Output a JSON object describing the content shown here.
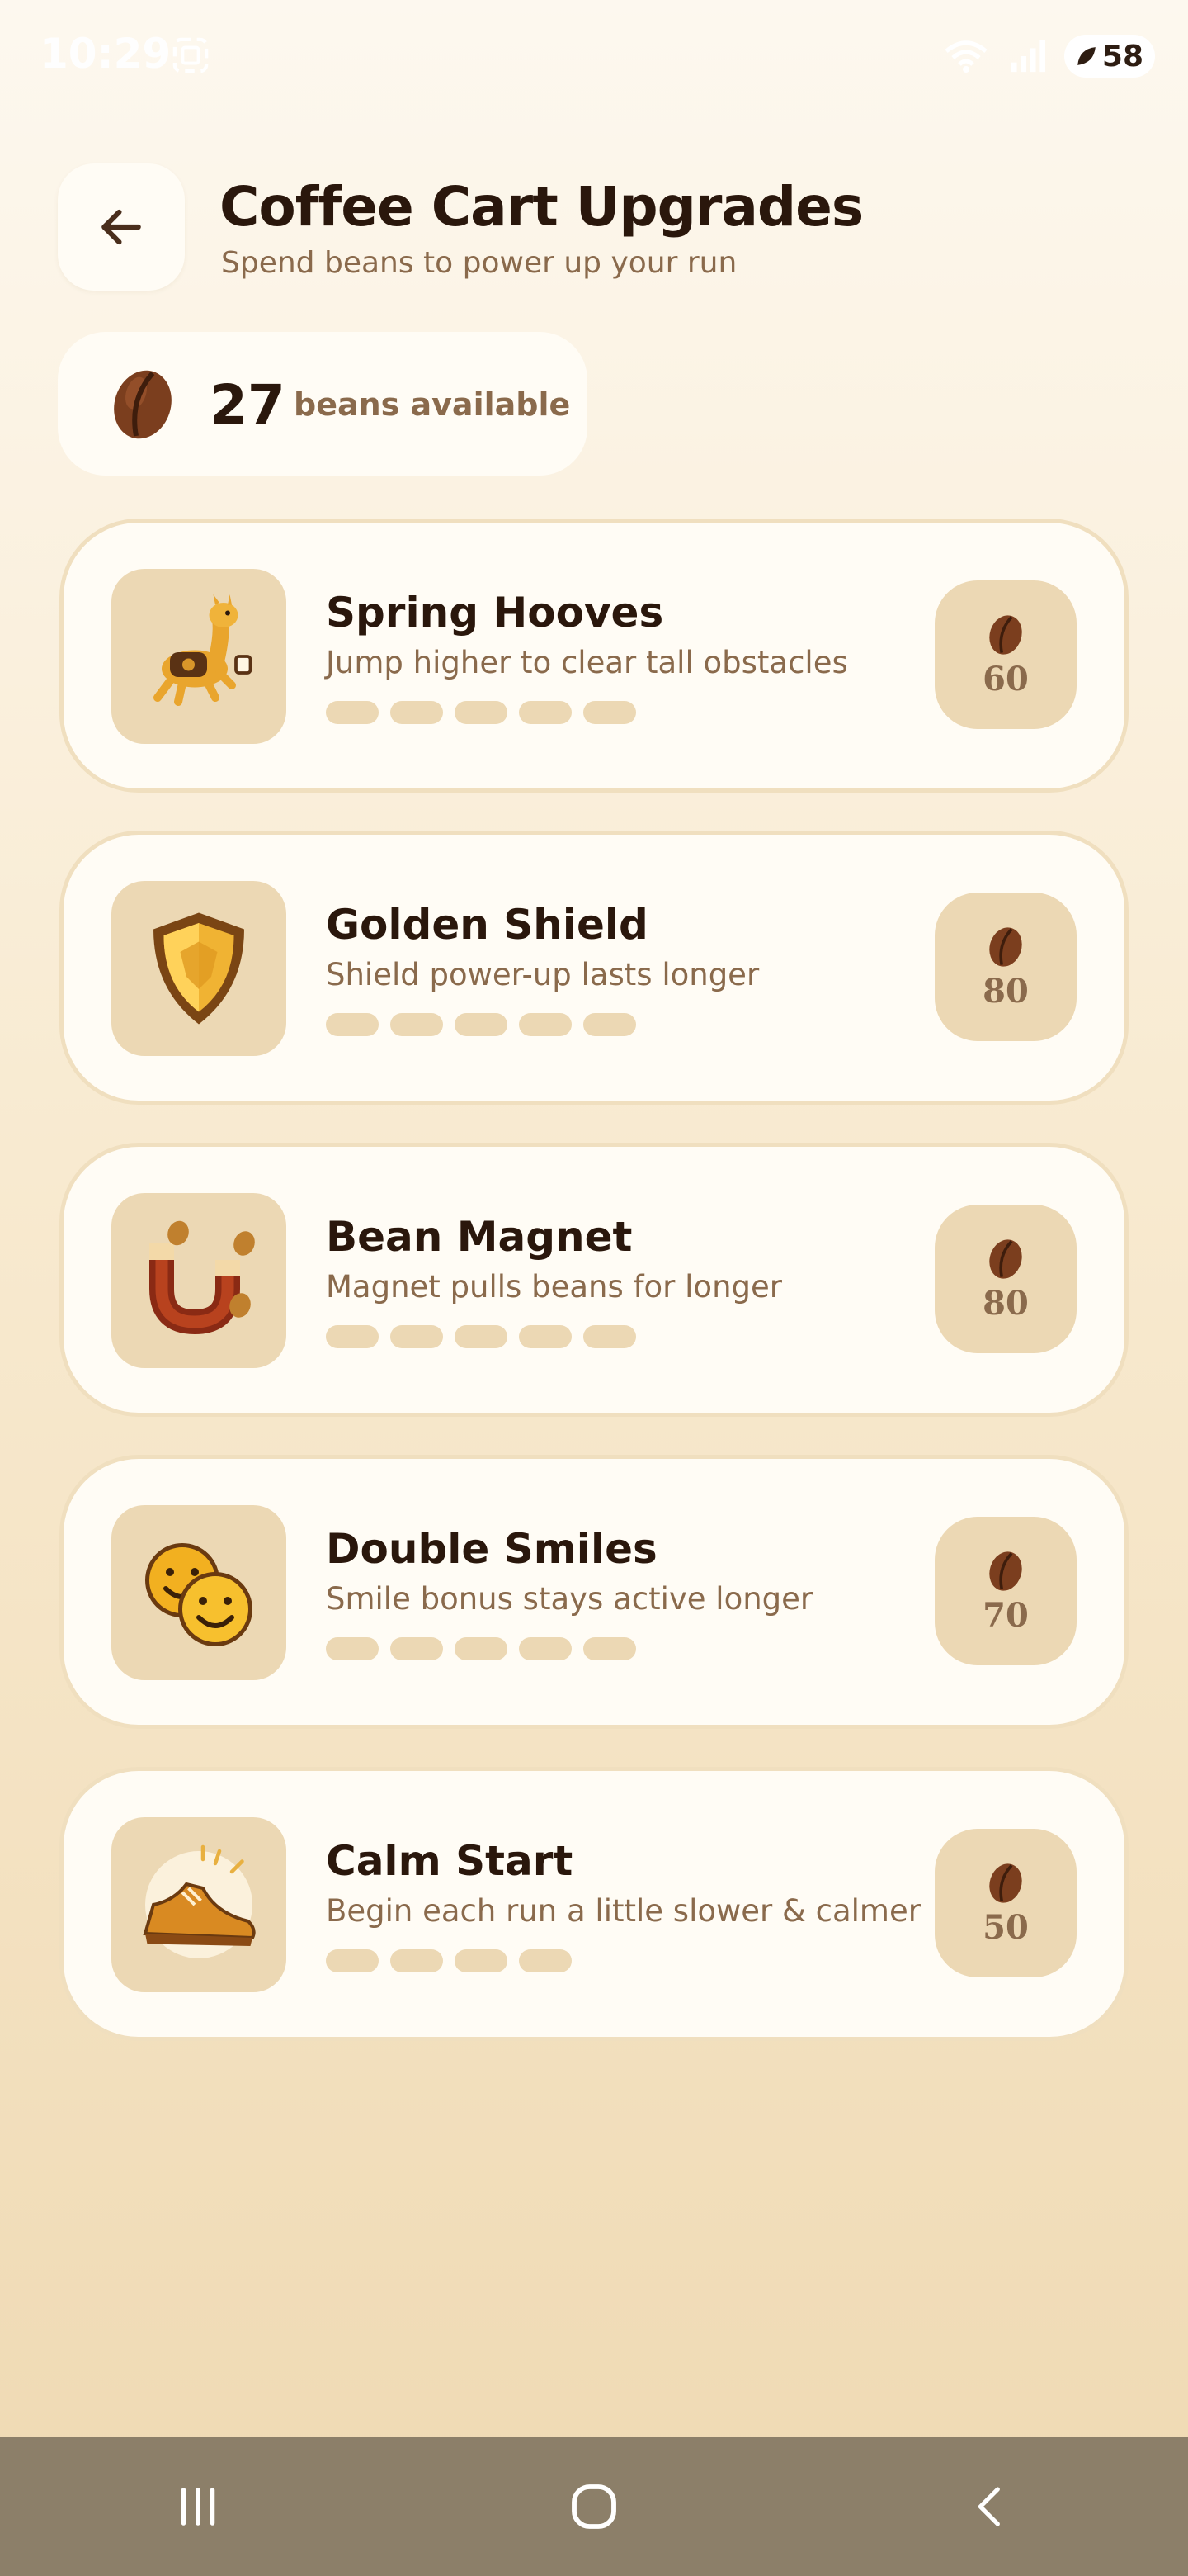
{
  "status_bar": {
    "time": "10:29",
    "battery": "58",
    "icons": [
      "screenshot-icon",
      "wifi-icon",
      "signal-icon",
      "battery-icon"
    ]
  },
  "header": {
    "back_icon": "arrow-left-icon",
    "title": "Coffee Cart Upgrades",
    "subtitle": "Spend beans to power up your run"
  },
  "balance": {
    "icon": "coffee-bean-icon",
    "count": "27",
    "label": "beans available"
  },
  "upgrades": [
    {
      "name": "Spring Hooves",
      "description": "Jump higher to clear tall obstacles",
      "price": "60",
      "icon": "llama-icon",
      "level_slots": 5,
      "level_filled": 0
    },
    {
      "name": "Golden Shield",
      "description": "Shield power-up lasts longer",
      "price": "80",
      "icon": "shield-icon",
      "level_slots": 5,
      "level_filled": 0
    },
    {
      "name": "Bean Magnet",
      "description": "Magnet pulls beans for longer",
      "price": "80",
      "icon": "magnet-icon",
      "level_slots": 5,
      "level_filled": 0
    },
    {
      "name": "Double Smiles",
      "description": "Smile bonus stays active longer",
      "price": "70",
      "icon": "smiley-faces-icon",
      "level_slots": 5,
      "level_filled": 0
    },
    {
      "name": "Calm Start",
      "description": "Begin each run a little slower & calmer",
      "price": "50",
      "icon": "sneaker-icon",
      "level_slots": 4,
      "level_filled": 0
    }
  ],
  "nav": {
    "buttons": [
      "recents-icon",
      "home-icon",
      "back-icon"
    ]
  },
  "colors": {
    "card_bg": "#fffcf5",
    "accent_tan": "#ecd8b4",
    "text_dark": "#2a170c",
    "text_muted": "#8a6a4c",
    "bean": "#7b3e1e"
  }
}
